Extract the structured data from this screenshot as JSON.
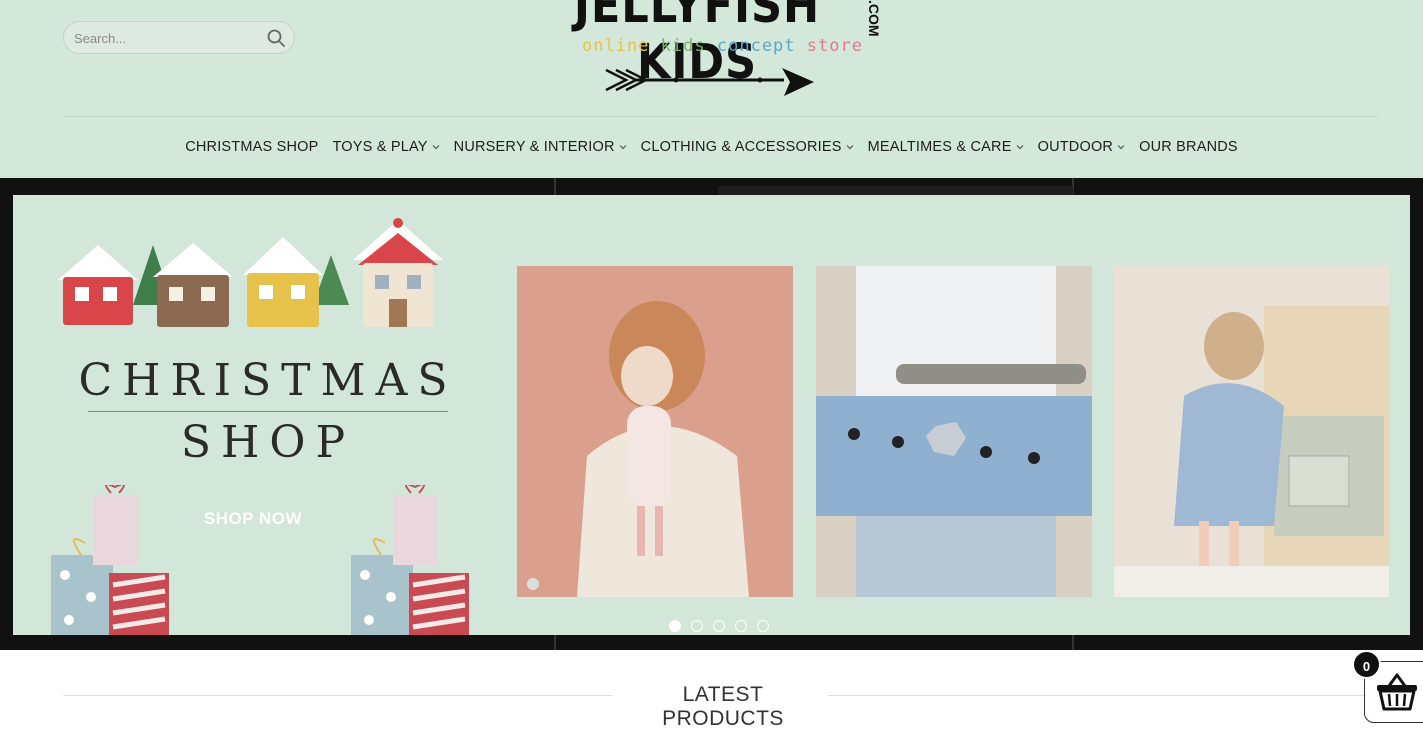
{
  "search": {
    "placeholder": "Search..."
  },
  "logo": {
    "title": "JELLYFISH KIDS",
    "suffix": ".COM",
    "tagline": [
      "online",
      "kids",
      "concept",
      "store"
    ],
    "tagline_colors": [
      "#e8c53a",
      "#7ab36a",
      "#5aa8c8",
      "#e07a8a"
    ]
  },
  "nav": {
    "items": [
      {
        "label": "CHRISTMAS SHOP",
        "dropdown": false
      },
      {
        "label": "TOYS & PLAY",
        "dropdown": true
      },
      {
        "label": "NURSERY & INTERIOR",
        "dropdown": true
      },
      {
        "label": "CLOTHING & ACCESSORIES",
        "dropdown": true
      },
      {
        "label": "MEALTIMES & CARE",
        "dropdown": true
      },
      {
        "label": "OUTDOOR",
        "dropdown": true
      },
      {
        "label": "OUR BRANDS",
        "dropdown": false
      }
    ]
  },
  "banner": {
    "headline": "CHRISTMAS",
    "subheadline": "SHOP",
    "cta": "SHOP NOW",
    "slides_total": 5,
    "active_slide": 1
  },
  "latest": {
    "title": "LATEST PRODUCTS"
  },
  "cart": {
    "count": "0"
  },
  "colors": {
    "header_bg": "#d3e8da",
    "banner_bg": "#d2e7d9",
    "text": "#1d1d1d"
  }
}
